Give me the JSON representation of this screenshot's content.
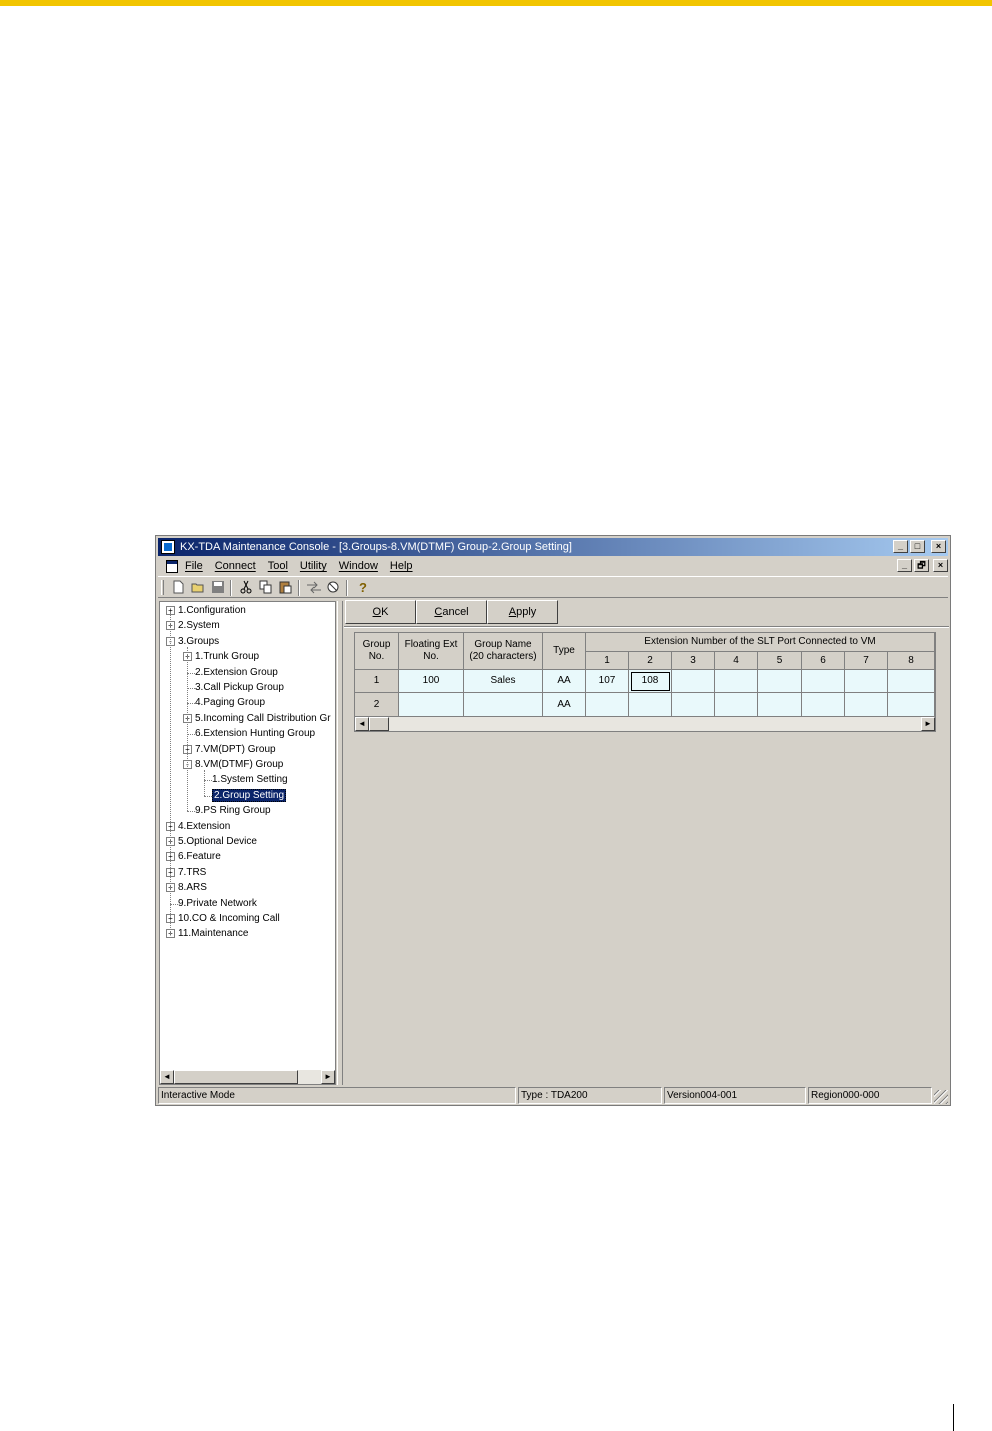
{
  "window": {
    "title": "KX-TDA Maintenance Console - [3.Groups-8.VM(DTMF) Group-2.Group Setting]",
    "buttons": {
      "minimize": "_",
      "maximize": "□",
      "restore": "🗗",
      "close": "×"
    }
  },
  "menubar": {
    "items": [
      "File",
      "Connect",
      "Tool",
      "Utility",
      "Window",
      "Help"
    ]
  },
  "toolbar": {
    "icons": [
      "new-icon",
      "open-icon",
      "save-icon",
      "cut-icon",
      "copy-icon",
      "paste-icon",
      "connect-icon",
      "disconnect-icon",
      "help-icon"
    ]
  },
  "tree": {
    "nodes": [
      {
        "label": "1.Configuration",
        "level": 0,
        "expander": "+"
      },
      {
        "label": "2.System",
        "level": 0,
        "expander": "+"
      },
      {
        "label": "3.Groups",
        "level": 0,
        "expander": "-"
      },
      {
        "label": "1.Trunk Group",
        "level": 1,
        "expander": "+"
      },
      {
        "label": "2.Extension Group",
        "level": 1,
        "expander": ""
      },
      {
        "label": "3.Call Pickup Group",
        "level": 1,
        "expander": ""
      },
      {
        "label": "4.Paging Group",
        "level": 1,
        "expander": ""
      },
      {
        "label": "5.Incoming Call Distribution Gr",
        "level": 1,
        "expander": "+"
      },
      {
        "label": "6.Extension Hunting Group",
        "level": 1,
        "expander": ""
      },
      {
        "label": "7.VM(DPT) Group",
        "level": 1,
        "expander": "+"
      },
      {
        "label": "8.VM(DTMF) Group",
        "level": 1,
        "expander": "-"
      },
      {
        "label": "1.System Setting",
        "level": 2,
        "expander": ""
      },
      {
        "label": "2.Group Setting",
        "level": 2,
        "expander": "",
        "selected": true
      },
      {
        "label": "9.PS Ring Group",
        "level": 1,
        "expander": ""
      },
      {
        "label": "4.Extension",
        "level": 0,
        "expander": "+"
      },
      {
        "label": "5.Optional Device",
        "level": 0,
        "expander": "+"
      },
      {
        "label": "6.Feature",
        "level": 0,
        "expander": "+"
      },
      {
        "label": "7.TRS",
        "level": 0,
        "expander": "+"
      },
      {
        "label": "8.ARS",
        "level": 0,
        "expander": "+"
      },
      {
        "label": "9.Private Network",
        "level": 0,
        "expander": ""
      },
      {
        "label": "10.CO & Incoming Call",
        "level": 0,
        "expander": "+"
      },
      {
        "label": "11.Maintenance",
        "level": 0,
        "expander": "+"
      }
    ]
  },
  "actions": {
    "ok": {
      "mnemonic": "O",
      "rest": "K"
    },
    "cancel": {
      "mnemonic": "C",
      "rest": "ancel"
    },
    "apply": {
      "mnemonic": "A",
      "rest": "pply"
    }
  },
  "grid": {
    "headers": {
      "group_no": [
        "Group",
        "No."
      ],
      "floating_ext": [
        "Floating Ext",
        "No."
      ],
      "group_name": [
        "Group Name",
        "(20 characters)"
      ],
      "type": "Type",
      "ext_group": "Extension Number of the SLT Port Connected to VM",
      "ext_cols": [
        "1",
        "2",
        "3",
        "4",
        "5",
        "6",
        "7",
        "8"
      ]
    },
    "rows": [
      {
        "group_no": "1",
        "floating_ext": "100",
        "group_name": "Sales",
        "type": "AA",
        "ext": [
          "107",
          "108",
          "",
          "",
          "",
          "",
          "",
          ""
        ]
      },
      {
        "group_no": "2",
        "floating_ext": "",
        "group_name": "",
        "type": "AA",
        "ext": [
          "",
          "",
          "",
          "",
          "",
          "",
          "",
          ""
        ]
      }
    ]
  },
  "statusbar": {
    "mode": "Interactive Mode",
    "type": "Type : TDA200",
    "version": "Version004-001",
    "region": "Region000-000"
  },
  "scroll": {
    "left_arrow": "◄",
    "right_arrow": "►"
  },
  "colors": {
    "title_start": "#0a246a",
    "title_end": "#a6caf0",
    "grid_cell": "#e9f9fb",
    "page_accent": "#f2c500"
  }
}
